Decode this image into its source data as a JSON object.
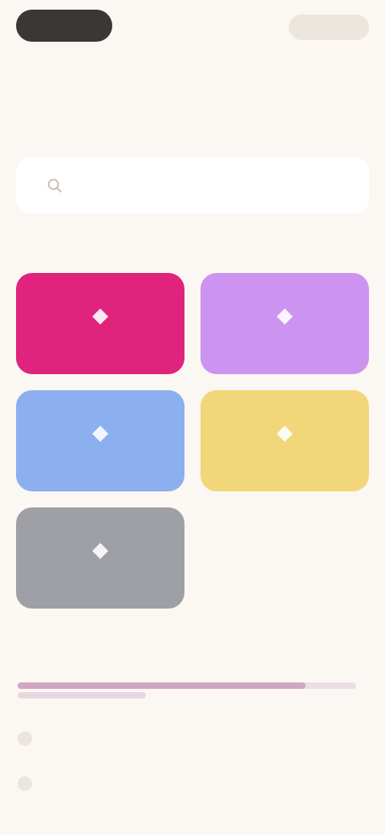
{
  "topbar": {
    "left_label": "",
    "right_label": ""
  },
  "title": "",
  "section": {
    "label": ""
  },
  "search": {
    "placeholder": ""
  },
  "categories": {
    "label": "",
    "tiles": [
      {
        "label": "",
        "icon": "tile-icon",
        "color": "#e0237d"
      },
      {
        "label": "",
        "icon": "tile-icon",
        "color": "#cd93f0"
      },
      {
        "label": "",
        "icon": "tile-icon",
        "color": "#8cb0ef"
      },
      {
        "label": "",
        "icon": "tile-icon",
        "color": "#f1d779"
      },
      {
        "label": "",
        "icon": "tile-icon",
        "color": "#9fa0a5"
      }
    ]
  },
  "list": {
    "title": "",
    "link": "",
    "progress": 0.85,
    "rows": [
      {
        "label": "",
        "value": ""
      },
      {
        "label": "",
        "value": ""
      }
    ]
  }
}
